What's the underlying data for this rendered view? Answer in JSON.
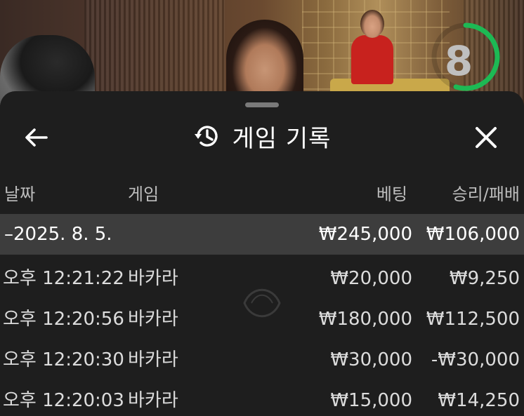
{
  "timer": {
    "value": "8",
    "fraction_remaining": 0.55,
    "color": "#1db954"
  },
  "header": {
    "title": "게임 기록"
  },
  "columns": {
    "date": "날짜",
    "game": "게임",
    "bet": "베팅",
    "result": "승리/패배"
  },
  "date_group": {
    "label": "–2025. 8. 5.",
    "bet_total": "₩245,000",
    "result_total": "₩106,000"
  },
  "rows": [
    {
      "time": "오후 12:21:22",
      "game": "바카라",
      "bet": "₩20,000",
      "result": "₩9,250"
    },
    {
      "time": "오후 12:20:56",
      "game": "바카라",
      "bet": "₩180,000",
      "result": "₩112,500"
    },
    {
      "time": "오후 12:20:30",
      "game": "바카라",
      "bet": "₩30,000",
      "result": "-₩30,000"
    },
    {
      "time": "오후 12:20:03",
      "game": "바카라",
      "bet": "₩15,000",
      "result": "₩14,250"
    }
  ],
  "icons": {
    "back": "arrow-left-icon",
    "history": "history-icon",
    "close": "close-icon"
  }
}
